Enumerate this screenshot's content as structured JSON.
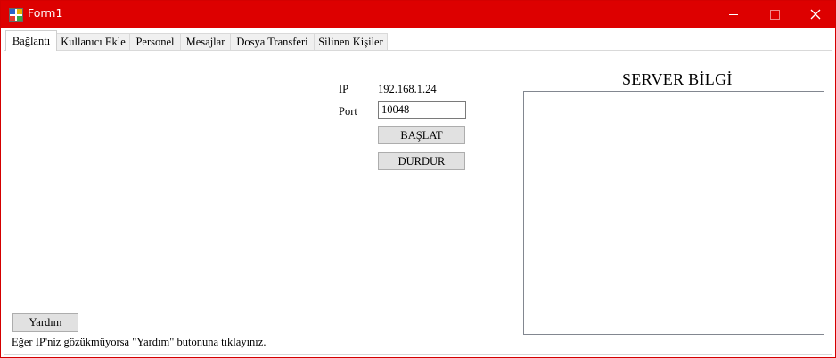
{
  "window": {
    "title": "Form1"
  },
  "tabs": [
    {
      "label": "Bağlantı"
    },
    {
      "label": "Kullanıcı Ekle"
    },
    {
      "label": "Personel"
    },
    {
      "label": "Mesajlar"
    },
    {
      "label": "Dosya Transferi"
    },
    {
      "label": "Silinen Kişiler"
    }
  ],
  "connection": {
    "ip_label": "IP",
    "ip_value": "192.168.1.24",
    "port_label": "Port",
    "port_value": "10048",
    "start_button": "BAŞLAT",
    "stop_button": "DURDUR"
  },
  "server_info": {
    "title": "SERVER BİLGİ"
  },
  "help": {
    "button": "Yardım",
    "hint": "Eğer IP'niz gözükmüyorsa \"Yardım\" butonuna tıklayınız."
  },
  "colors": {
    "titlebar": "#dd0000",
    "button_face": "#e1e1e1"
  },
  "icons": [
    "app-icon",
    "minimize-icon",
    "maximize-icon",
    "close-icon"
  ]
}
